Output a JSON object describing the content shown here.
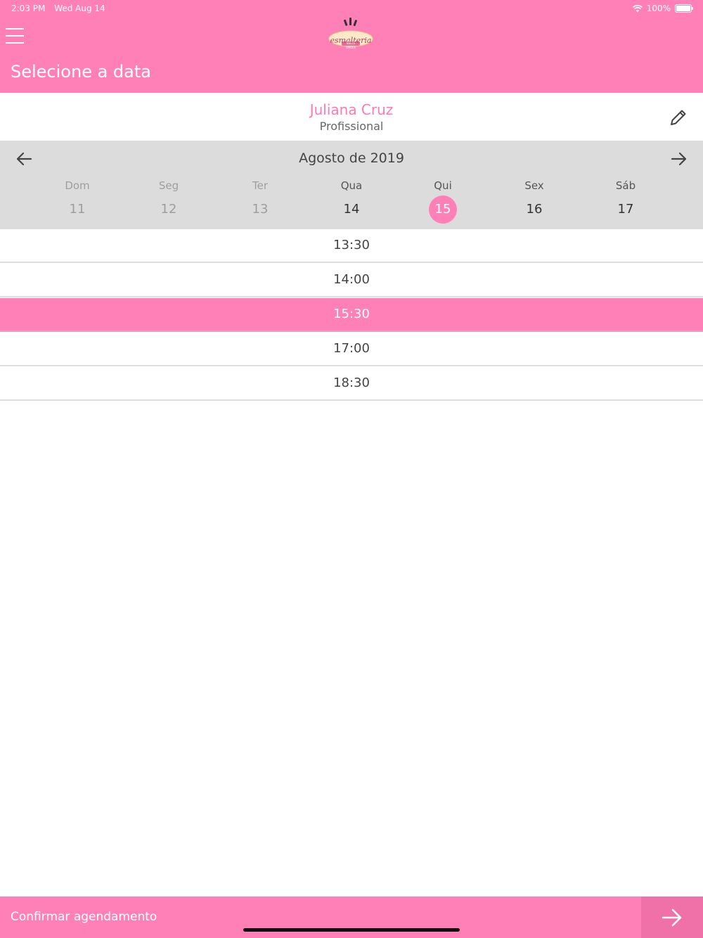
{
  "status_bar": {
    "time": "2:03 PM",
    "date": "Wed Aug 14",
    "battery": "100%"
  },
  "header": {
    "title": "Selecione a data",
    "logo_text": "esmalteria",
    "logo_sub": "BELLE ONGLE"
  },
  "professional": {
    "name": "Juliana Cruz",
    "role": "Profissional"
  },
  "calendar": {
    "month": "Agosto de 2019",
    "days": [
      {
        "name": "Dom",
        "num": "11",
        "state": "past"
      },
      {
        "name": "Seg",
        "num": "12",
        "state": "past"
      },
      {
        "name": "Ter",
        "num": "13",
        "state": "past"
      },
      {
        "name": "Qua",
        "num": "14",
        "state": "available"
      },
      {
        "name": "Qui",
        "num": "15",
        "state": "selected"
      },
      {
        "name": "Sex",
        "num": "16",
        "state": "available"
      },
      {
        "name": "Sáb",
        "num": "17",
        "state": "available"
      }
    ]
  },
  "times": [
    {
      "label": "13:30",
      "selected": false
    },
    {
      "label": "14:00",
      "selected": false
    },
    {
      "label": "15:30",
      "selected": true
    },
    {
      "label": "17:00",
      "selected": false
    },
    {
      "label": "18:30",
      "selected": false
    }
  ],
  "footer": {
    "confirm_label": "Confirmar agendamento"
  },
  "colors": {
    "accent": "#ff80b6",
    "accent_dark": "#f070a8",
    "name_pink": "#ff79b0",
    "calendar_bg": "#dcdcdc"
  },
  "icons": [
    "wifi-icon",
    "battery-icon",
    "menu-icon",
    "edit-pencil-icon",
    "arrow-left-icon",
    "arrow-right-icon"
  ]
}
